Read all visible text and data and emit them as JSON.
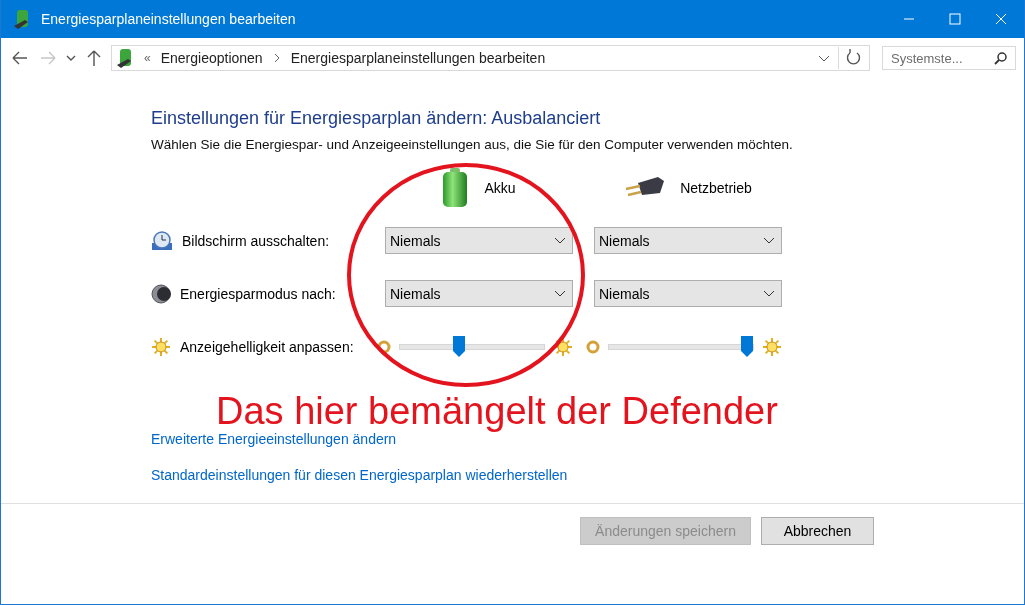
{
  "window": {
    "title": "Energiesparplaneinstellungen bearbeiten"
  },
  "address_bar": {
    "breadcrumbs": [
      "Energieoptionen",
      "Energiesparplaneinstellungen bearbeiten"
    ],
    "separator_lead": "«",
    "search": {
      "placeholder": "Systemste..."
    }
  },
  "heading": "Einstellungen für Energiesparplan ändern: Ausbalanciert",
  "description": "Wählen Sie die Energiespar- und Anzeigeeinstellungen aus, die Sie für den Computer verwenden möchten.",
  "columns": [
    {
      "label": "Akku",
      "kind": "battery"
    },
    {
      "label": "Netzbetrieb",
      "kind": "plug"
    }
  ],
  "settings": [
    {
      "label": "Bildschirm ausschalten:",
      "kind": "dropdown",
      "values": [
        "Niemals",
        "Niemals"
      ]
    },
    {
      "label": "Energiesparmodus nach:",
      "kind": "dropdown",
      "values": [
        "Niemals",
        "Niemals"
      ]
    },
    {
      "label": "Anzeigehelligkeit anpassen:",
      "kind": "slider",
      "sliders": [
        {
          "level": 0.41
        },
        {
          "level": 0.95
        }
      ]
    }
  ],
  "links": [
    "Erweiterte Energieeinstellungen ändern",
    "Standardeinstellungen für diesen Energiesparplan wiederherstellen"
  ],
  "buttons": [
    {
      "label": "Änderungen speichern",
      "disabled": true
    },
    {
      "label": "Abbrechen",
      "disabled": false
    }
  ],
  "annotation": {
    "text": "Das hier bemängelt der Defender"
  }
}
